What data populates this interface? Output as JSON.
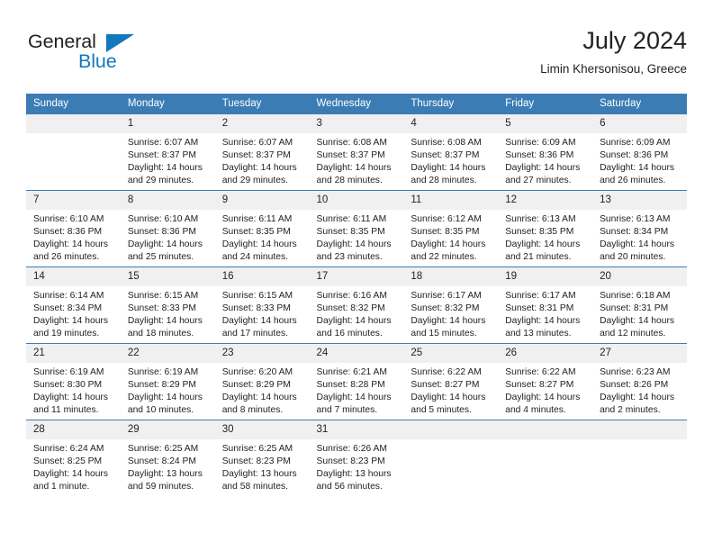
{
  "brand": {
    "name_part1": "General",
    "name_part2": "Blue",
    "accent_color": "#1278be"
  },
  "header": {
    "month_year": "July 2024",
    "location": "Limin Khersonisou, Greece"
  },
  "calendar": {
    "header_bg": "#3b7cb5",
    "weekday_headers": [
      "Sunday",
      "Monday",
      "Tuesday",
      "Wednesday",
      "Thursday",
      "Friday",
      "Saturday"
    ],
    "weeks": [
      [
        {
          "day": "",
          "sunrise": "",
          "sunset": "",
          "daylight1": "",
          "daylight2": ""
        },
        {
          "day": "1",
          "sunrise": "Sunrise: 6:07 AM",
          "sunset": "Sunset: 8:37 PM",
          "daylight1": "Daylight: 14 hours",
          "daylight2": "and 29 minutes."
        },
        {
          "day": "2",
          "sunrise": "Sunrise: 6:07 AM",
          "sunset": "Sunset: 8:37 PM",
          "daylight1": "Daylight: 14 hours",
          "daylight2": "and 29 minutes."
        },
        {
          "day": "3",
          "sunrise": "Sunrise: 6:08 AM",
          "sunset": "Sunset: 8:37 PM",
          "daylight1": "Daylight: 14 hours",
          "daylight2": "and 28 minutes."
        },
        {
          "day": "4",
          "sunrise": "Sunrise: 6:08 AM",
          "sunset": "Sunset: 8:37 PM",
          "daylight1": "Daylight: 14 hours",
          "daylight2": "and 28 minutes."
        },
        {
          "day": "5",
          "sunrise": "Sunrise: 6:09 AM",
          "sunset": "Sunset: 8:36 PM",
          "daylight1": "Daylight: 14 hours",
          "daylight2": "and 27 minutes."
        },
        {
          "day": "6",
          "sunrise": "Sunrise: 6:09 AM",
          "sunset": "Sunset: 8:36 PM",
          "daylight1": "Daylight: 14 hours",
          "daylight2": "and 26 minutes."
        }
      ],
      [
        {
          "day": "7",
          "sunrise": "Sunrise: 6:10 AM",
          "sunset": "Sunset: 8:36 PM",
          "daylight1": "Daylight: 14 hours",
          "daylight2": "and 26 minutes."
        },
        {
          "day": "8",
          "sunrise": "Sunrise: 6:10 AM",
          "sunset": "Sunset: 8:36 PM",
          "daylight1": "Daylight: 14 hours",
          "daylight2": "and 25 minutes."
        },
        {
          "day": "9",
          "sunrise": "Sunrise: 6:11 AM",
          "sunset": "Sunset: 8:35 PM",
          "daylight1": "Daylight: 14 hours",
          "daylight2": "and 24 minutes."
        },
        {
          "day": "10",
          "sunrise": "Sunrise: 6:11 AM",
          "sunset": "Sunset: 8:35 PM",
          "daylight1": "Daylight: 14 hours",
          "daylight2": "and 23 minutes."
        },
        {
          "day": "11",
          "sunrise": "Sunrise: 6:12 AM",
          "sunset": "Sunset: 8:35 PM",
          "daylight1": "Daylight: 14 hours",
          "daylight2": "and 22 minutes."
        },
        {
          "day": "12",
          "sunrise": "Sunrise: 6:13 AM",
          "sunset": "Sunset: 8:35 PM",
          "daylight1": "Daylight: 14 hours",
          "daylight2": "and 21 minutes."
        },
        {
          "day": "13",
          "sunrise": "Sunrise: 6:13 AM",
          "sunset": "Sunset: 8:34 PM",
          "daylight1": "Daylight: 14 hours",
          "daylight2": "and 20 minutes."
        }
      ],
      [
        {
          "day": "14",
          "sunrise": "Sunrise: 6:14 AM",
          "sunset": "Sunset: 8:34 PM",
          "daylight1": "Daylight: 14 hours",
          "daylight2": "and 19 minutes."
        },
        {
          "day": "15",
          "sunrise": "Sunrise: 6:15 AM",
          "sunset": "Sunset: 8:33 PM",
          "daylight1": "Daylight: 14 hours",
          "daylight2": "and 18 minutes."
        },
        {
          "day": "16",
          "sunrise": "Sunrise: 6:15 AM",
          "sunset": "Sunset: 8:33 PM",
          "daylight1": "Daylight: 14 hours",
          "daylight2": "and 17 minutes."
        },
        {
          "day": "17",
          "sunrise": "Sunrise: 6:16 AM",
          "sunset": "Sunset: 8:32 PM",
          "daylight1": "Daylight: 14 hours",
          "daylight2": "and 16 minutes."
        },
        {
          "day": "18",
          "sunrise": "Sunrise: 6:17 AM",
          "sunset": "Sunset: 8:32 PM",
          "daylight1": "Daylight: 14 hours",
          "daylight2": "and 15 minutes."
        },
        {
          "day": "19",
          "sunrise": "Sunrise: 6:17 AM",
          "sunset": "Sunset: 8:31 PM",
          "daylight1": "Daylight: 14 hours",
          "daylight2": "and 13 minutes."
        },
        {
          "day": "20",
          "sunrise": "Sunrise: 6:18 AM",
          "sunset": "Sunset: 8:31 PM",
          "daylight1": "Daylight: 14 hours",
          "daylight2": "and 12 minutes."
        }
      ],
      [
        {
          "day": "21",
          "sunrise": "Sunrise: 6:19 AM",
          "sunset": "Sunset: 8:30 PM",
          "daylight1": "Daylight: 14 hours",
          "daylight2": "and 11 minutes."
        },
        {
          "day": "22",
          "sunrise": "Sunrise: 6:19 AM",
          "sunset": "Sunset: 8:29 PM",
          "daylight1": "Daylight: 14 hours",
          "daylight2": "and 10 minutes."
        },
        {
          "day": "23",
          "sunrise": "Sunrise: 6:20 AM",
          "sunset": "Sunset: 8:29 PM",
          "daylight1": "Daylight: 14 hours",
          "daylight2": "and 8 minutes."
        },
        {
          "day": "24",
          "sunrise": "Sunrise: 6:21 AM",
          "sunset": "Sunset: 8:28 PM",
          "daylight1": "Daylight: 14 hours",
          "daylight2": "and 7 minutes."
        },
        {
          "day": "25",
          "sunrise": "Sunrise: 6:22 AM",
          "sunset": "Sunset: 8:27 PM",
          "daylight1": "Daylight: 14 hours",
          "daylight2": "and 5 minutes."
        },
        {
          "day": "26",
          "sunrise": "Sunrise: 6:22 AM",
          "sunset": "Sunset: 8:27 PM",
          "daylight1": "Daylight: 14 hours",
          "daylight2": "and 4 minutes."
        },
        {
          "day": "27",
          "sunrise": "Sunrise: 6:23 AM",
          "sunset": "Sunset: 8:26 PM",
          "daylight1": "Daylight: 14 hours",
          "daylight2": "and 2 minutes."
        }
      ],
      [
        {
          "day": "28",
          "sunrise": "Sunrise: 6:24 AM",
          "sunset": "Sunset: 8:25 PM",
          "daylight1": "Daylight: 14 hours",
          "daylight2": "and 1 minute."
        },
        {
          "day": "29",
          "sunrise": "Sunrise: 6:25 AM",
          "sunset": "Sunset: 8:24 PM",
          "daylight1": "Daylight: 13 hours",
          "daylight2": "and 59 minutes."
        },
        {
          "day": "30",
          "sunrise": "Sunrise: 6:25 AM",
          "sunset": "Sunset: 8:23 PM",
          "daylight1": "Daylight: 13 hours",
          "daylight2": "and 58 minutes."
        },
        {
          "day": "31",
          "sunrise": "Sunrise: 6:26 AM",
          "sunset": "Sunset: 8:23 PM",
          "daylight1": "Daylight: 13 hours",
          "daylight2": "and 56 minutes."
        },
        {
          "day": "",
          "sunrise": "",
          "sunset": "",
          "daylight1": "",
          "daylight2": ""
        },
        {
          "day": "",
          "sunrise": "",
          "sunset": "",
          "daylight1": "",
          "daylight2": ""
        },
        {
          "day": "",
          "sunrise": "",
          "sunset": "",
          "daylight1": "",
          "daylight2": ""
        }
      ]
    ]
  }
}
